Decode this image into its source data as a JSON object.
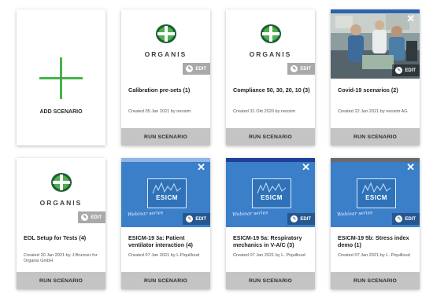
{
  "add_scenario": {
    "label": "ADD SCENARIO"
  },
  "cards": [
    {
      "logo_text": "ORGANIS",
      "edit_label": "EDIT",
      "title": "Calibration pre-sets (1)",
      "created": "Created  05 Jan 2021 by neosim",
      "run_label": "RUN SCENARIO"
    },
    {
      "logo_text": "ORGANIS",
      "edit_label": "EDIT",
      "title": "Compliance 50, 30, 20, 10 (3)",
      "created": "Created  31 Okt 2020 by neosim",
      "run_label": "RUN SCENARIO"
    },
    {
      "edit_label": "EDIT",
      "title": "Covid-19 scenarios (2)",
      "created": "Created  22 Jan 2021 by neosim AG",
      "run_label": "RUN SCENARIO",
      "accent_color": "#2c64b3"
    },
    {
      "logo_text": "ORGANIS",
      "edit_label": "EDIT",
      "title": "EOL Setup for Tests (4)",
      "created": "Created  20 Jan 2021 by J.Brunner for Organis GmbH",
      "run_label": "RUN SCENARIO"
    },
    {
      "esicm_text": "ESICM",
      "script_text": "Webinar series",
      "edit_label": "EDIT",
      "title": "ESICM-19 3a: Patient ventilator interaction (4)",
      "created": "Created  07 Jan 2021 by L.Piquilloud",
      "run_label": "RUN SCENARIO",
      "accent_color": "#8fb7e3"
    },
    {
      "esicm_text": "ESICM",
      "script_text": "Webinar series",
      "edit_label": "EDIT",
      "title": "ESICM-19 5a: Respiratory mechanics in V-A/C (3)",
      "created": "Created  07 Jan 2021 by L. Piquilloud",
      "run_label": "RUN SCENARIO",
      "accent_color": "#1f3f9a"
    },
    {
      "esicm_text": "ESICM",
      "script_text": "Webinar series",
      "edit_label": "EDIT",
      "title": "ESICM-19 5b: Stress index demo (1)",
      "created": "Created  07 Jan 2021 by L. Piquilloud",
      "run_label": "RUN SCENARIO",
      "accent_color": "#6a6a6a"
    }
  ],
  "colors": {
    "plus_green": "#43b649",
    "run_bar": "#c4c4c4",
    "esicm_blue": "#3b7fc9"
  }
}
